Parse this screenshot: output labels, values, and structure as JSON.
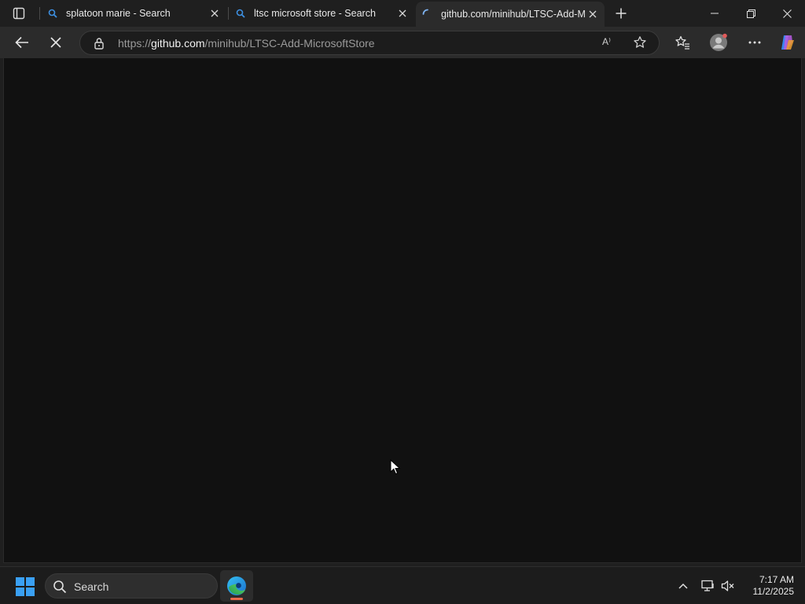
{
  "browser": {
    "tabs": [
      {
        "title": "splatoon marie - Search",
        "icon": "search-favicon",
        "active": false
      },
      {
        "title": "ltsc microsoft store - Search",
        "icon": "search-favicon",
        "active": false
      },
      {
        "title": "github.com/minihub/LTSC-Add-M",
        "icon": "loading-spinner",
        "active": true
      }
    ],
    "address": {
      "prefix": "https://",
      "host": "github.com",
      "path": "/minihub/LTSC-Add-MicrosoftStore"
    },
    "read_aloud_label": "A⁾",
    "colors": {
      "accent": "#3aa0f3",
      "loading": "#7eb3f0",
      "copilot": "#e76a4b"
    }
  },
  "taskbar": {
    "search_label": "Search",
    "time": "7:17 AM",
    "date": "11/2/2025"
  }
}
